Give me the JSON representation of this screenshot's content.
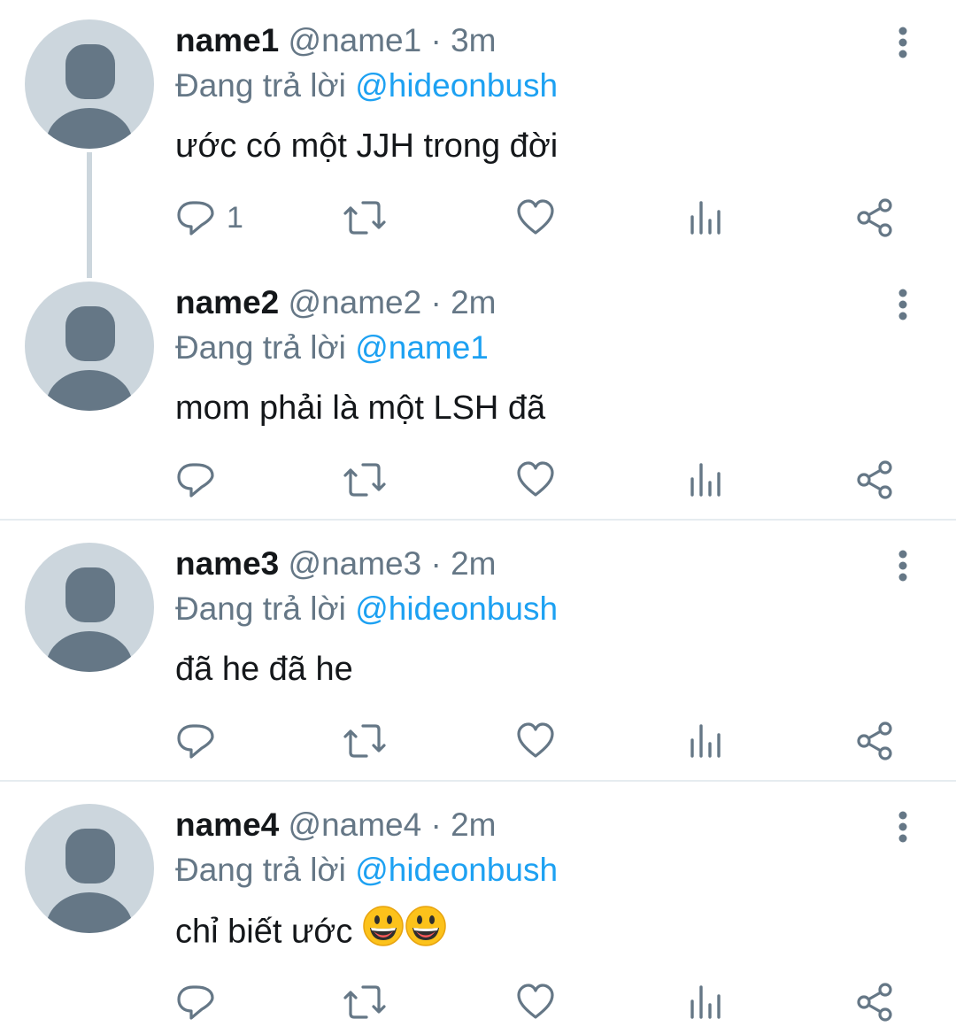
{
  "tweets": [
    {
      "name": "name1",
      "handle": "@name1",
      "dot": "·",
      "time": "3m",
      "reply_prefix": "Đang trả lời",
      "reply_to": "@hideonbush",
      "text": "ước có một JJH trong đời",
      "reply_count": "1"
    },
    {
      "name": "name2",
      "handle": "@name2",
      "dot": "·",
      "time": "2m",
      "reply_prefix": "Đang trả lời",
      "reply_to": "@name1",
      "text": "mom phải là một LSH đã",
      "reply_count": ""
    },
    {
      "name": "name3",
      "handle": "@name3",
      "dot": "·",
      "time": "2m",
      "reply_prefix": "Đang trả lời",
      "reply_to": "@hideonbush",
      "text": "đã he đã he",
      "reply_count": ""
    },
    {
      "name": "name4",
      "handle": "@name4",
      "dot": "·",
      "time": "2m",
      "reply_prefix": "Đang trả lời",
      "reply_to": "@hideonbush",
      "text": "chỉ biết ước",
      "text_emoji": [
        "grinning-face-emoji",
        "grinning-face-emoji"
      ],
      "reply_count": ""
    }
  ],
  "icons": {
    "more": "more-vertical-icon",
    "reply": "reply-icon",
    "retweet": "retweet-icon",
    "like": "heart-icon",
    "analytics": "analytics-icon",
    "share": "share-icon"
  },
  "colors": {
    "text": "#14171a",
    "secondary": "#657786",
    "mention": "#1da1f2",
    "avatar_bg": "#ccd6dd",
    "divider": "#e6ecf0"
  }
}
